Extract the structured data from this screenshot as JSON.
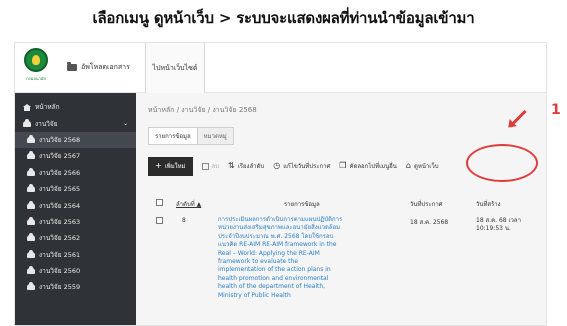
{
  "headline": "เลือกเมนู ดูหน้าเว็บ > ระบบจะแสดงผลที่ท่านนำข้อมูลเข้ามา",
  "logo": {
    "text": "กรมอนามัย"
  },
  "topbar": {
    "download_label": "อัพโหลดเอกสาร",
    "view_site_label": "ไปหน้าเว็บไซต์"
  },
  "sidebar": {
    "home": "หน้าหลัก",
    "research": "งานวิจัย",
    "years": [
      "งานวิจัย 2568",
      "งานวิจัย 2567",
      "งานวิจัย 2566",
      "งานวิจัย 2565",
      "งานวิจัย 2564",
      "งานวิจัย 2563",
      "งานวิจัย 2562",
      "งานวิจัย 2561",
      "งานวิจัย 2560",
      "งานวิจัย 2559"
    ]
  },
  "breadcrumb": "หน้าหลัก  /  งานวิจัย  /  งานวิจัย 2568",
  "tabs": {
    "items": "รายการข้อมูล",
    "category": "หมวดหมู่"
  },
  "toolbar": {
    "add": "เพิ่มใหม่",
    "delete": "ลบ",
    "sort": "เรียงลำดับ",
    "date": "แก้ไขวันที่ประกาศ",
    "copy": "คัดลอกไปที่เมนูอื่น",
    "view": "ดูหน้าเว็บ"
  },
  "table": {
    "col_order": "ลำดับที่ ▲",
    "col_item": "รายการข้อมูล",
    "col_published": "วันที่ประกาศ",
    "col_created": "วันที่สร้าง",
    "row": {
      "order": "8",
      "desc": "การประเมินผลการดำเนินการตามแผนปฏิบัติการหน่วยงานส่งเสริมสุขภาพและอนามัยสิ่งแวดล้อม ประจำปีงบประมาณ พ.ศ. 2568 โดยใช้กรอบแนวคิด RE-AIM RE-AIM framework in the Real – World: Applying the RE-AIM framework to evaluate the implementation of the action plans in health promotion and environmental health of the department of Health, Ministry of Public Health",
      "published": "18 ส.ค. 2568",
      "created": "18 ส.ค. 68 เวลา 10:19:53 น."
    }
  },
  "annotation": {
    "number": "1"
  }
}
